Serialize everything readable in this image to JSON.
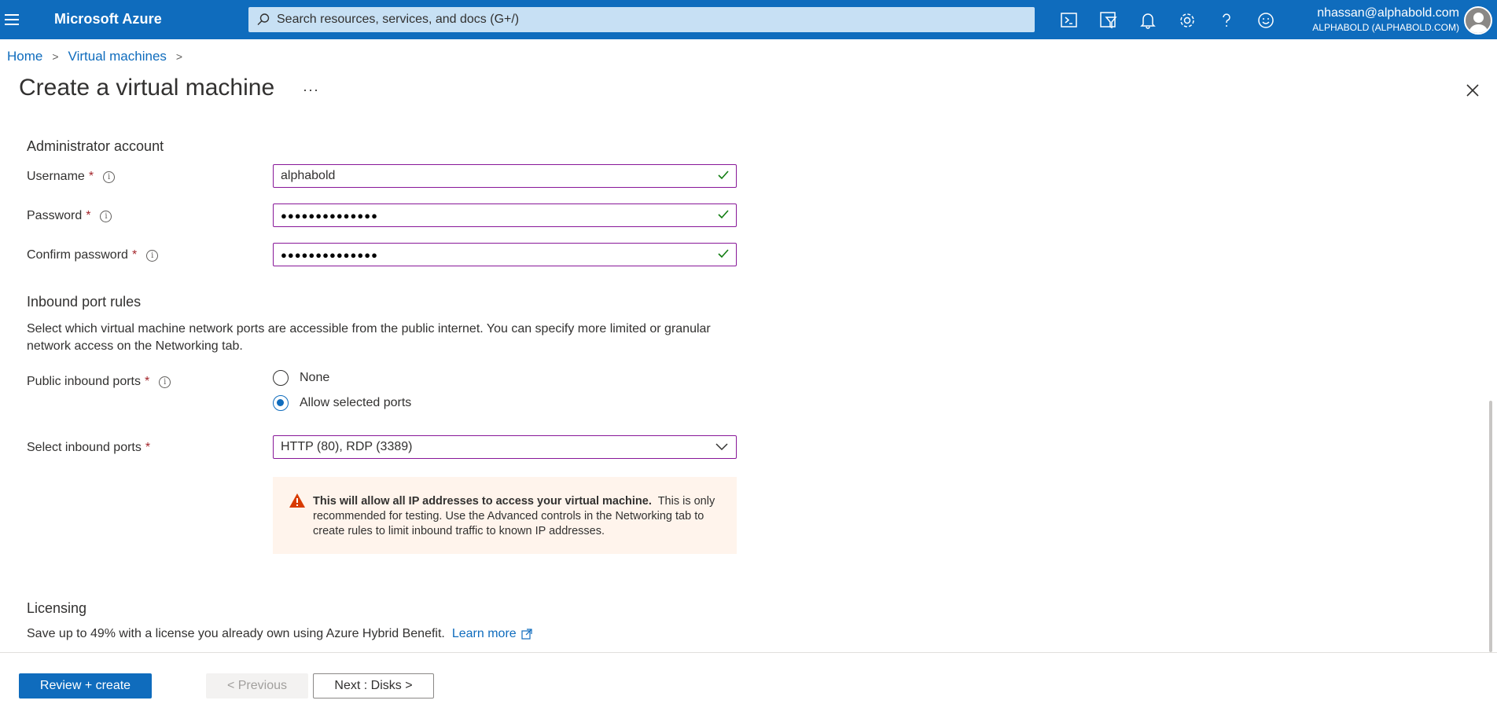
{
  "topbar": {
    "brand": "Microsoft Azure",
    "search_placeholder": "Search resources, services, and docs (G+/)",
    "icons": [
      "cloud-shell-icon",
      "directory-filter-icon",
      "notifications-bell-icon",
      "settings-gear-icon",
      "help-icon",
      "feedback-smiley-icon"
    ],
    "user_email": "nhassan@alphabold.com",
    "user_tenant": "ALPHABOLD (ALPHABOLD.COM)"
  },
  "breadcrumb": {
    "home": "Home",
    "virtual_machines": "Virtual machines"
  },
  "page": {
    "title": "Create a virtual machine",
    "more": "···"
  },
  "admin": {
    "heading": "Administrator account",
    "username_label": "Username",
    "username_value": "alphabold",
    "password_label": "Password",
    "password_value": "●●●●●●●●●●●●●●",
    "confirm_label": "Confirm password",
    "confirm_value": "●●●●●●●●●●●●●●"
  },
  "inbound": {
    "heading": "Inbound port rules",
    "description": "Select which virtual machine network ports are accessible from the public internet. You can specify more limited or granular network access on the Networking tab.",
    "public_label": "Public inbound ports",
    "option_none": "None",
    "option_allow": "Allow selected ports",
    "selected_option": "Allow selected ports",
    "select_label": "Select inbound ports",
    "select_value": "HTTP (80), RDP (3389)",
    "warning_bold": "This will allow all IP addresses to access your virtual machine.",
    "warning_text": "This is only recommended for testing.  Use the Advanced controls in the Networking tab to create rules to limit inbound traffic to known IP addresses."
  },
  "licensing": {
    "heading": "Licensing",
    "text": "Save up to 49% with a license you already own using Azure Hybrid Benefit.",
    "link": "Learn more"
  },
  "footer": {
    "review_create": "Review + create",
    "previous": "< Previous",
    "next": "Next : Disks >"
  },
  "colors": {
    "accent": "#0f6cbd",
    "field_border": "#881798",
    "valid": "#107c10",
    "warning_bg": "#fff4ec",
    "warning_icon": "#d83b01",
    "required": "#a4262c"
  }
}
